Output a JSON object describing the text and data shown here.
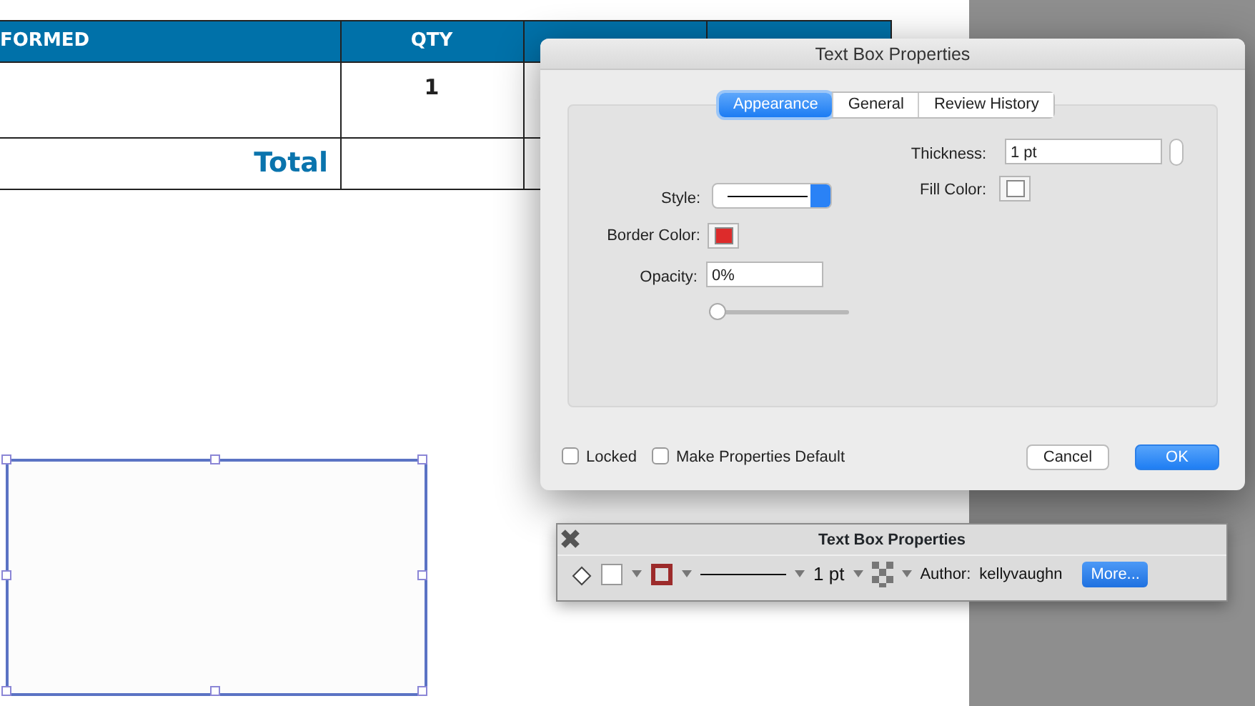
{
  "table": {
    "columns": [
      "FORMED",
      "QTY",
      "",
      ""
    ],
    "rows": [
      {
        "kind": "item",
        "cells": [
          "",
          "1",
          "",
          ""
        ]
      },
      {
        "kind": "total",
        "cells": [
          "Total",
          "",
          "",
          ""
        ]
      }
    ]
  },
  "dialog": {
    "title": "Text Box Properties",
    "tabs": [
      {
        "label": "Appearance",
        "selected": true
      },
      {
        "label": "General",
        "selected": false
      },
      {
        "label": "Review History",
        "selected": false
      }
    ],
    "thickness": {
      "label": "Thickness:",
      "value": "1 pt"
    },
    "style": {
      "label": "Style:"
    },
    "swatches": [
      {
        "label": "Border Color:",
        "color": "#dd2b2b"
      },
      {
        "label": "Fill Color:",
        "color": "#ffffff"
      }
    ],
    "opacity": {
      "label": "Opacity:",
      "value": "0%",
      "level": 0
    },
    "checkboxes": [
      {
        "label": "Locked",
        "checked": false
      },
      {
        "label": "Make Properties Default",
        "checked": false
      }
    ],
    "buttons": [
      {
        "label": "Cancel",
        "kind": "default"
      },
      {
        "label": "OK",
        "kind": "primary"
      }
    ]
  },
  "toolbar": {
    "title": "Text Box Properties",
    "thickness": "1 pt",
    "author_label": "Author:",
    "author": "kellyvaughn",
    "more": "More..."
  }
}
